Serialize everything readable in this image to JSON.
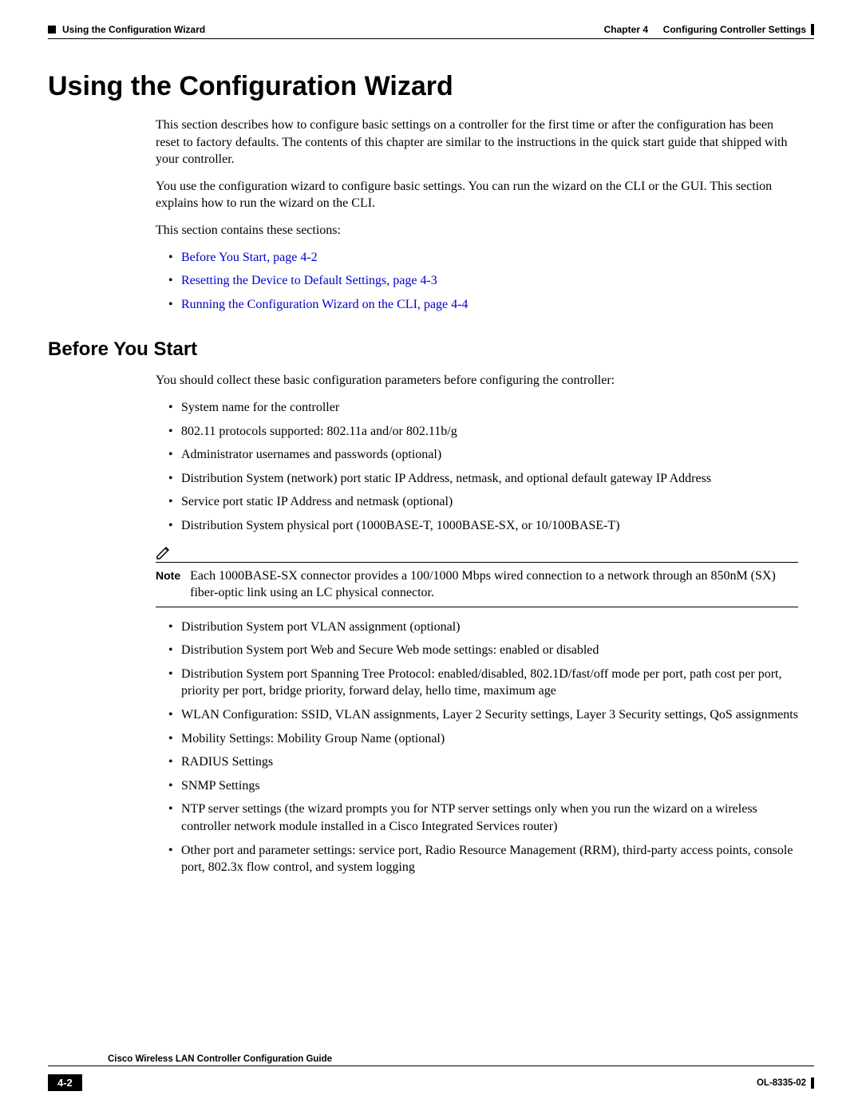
{
  "header": {
    "section_marker": "Using the Configuration Wizard",
    "chapter_label": "Chapter 4",
    "chapter_title": "Configuring Controller Settings"
  },
  "title": "Using the Configuration Wizard",
  "intro": {
    "p1": "This section describes how to configure basic settings on a controller for the first time or after the configuration has been reset to factory defaults. The contents of this chapter are similar to the instructions in the quick start guide that shipped with your controller.",
    "p2": "You use the configuration wizard to configure basic settings. You can run the wizard on the CLI or the GUI. This section explains how to run the wizard on the CLI.",
    "p3": "This section contains these sections:"
  },
  "toc_links": [
    "Before You Start, page 4-2",
    "Resetting the Device to Default Settings, page 4-3",
    "Running the Configuration Wizard on the CLI, page 4-4"
  ],
  "before_you_start": {
    "heading": "Before You Start",
    "intro": "You should collect these basic configuration parameters before configuring the controller:",
    "items_top": [
      "System name for the controller",
      "802.11 protocols supported: 802.11a and/or 802.11b/g",
      "Administrator usernames and passwords (optional)",
      "Distribution System (network) port static IP Address, netmask, and optional default gateway IP Address",
      "Service port static IP Address and netmask (optional)",
      "Distribution System physical port (1000BASE-T, 1000BASE-SX, or 10/100BASE-T)"
    ],
    "note_label": "Note",
    "note_text": "Each 1000BASE-SX connector provides a 100/1000 Mbps wired connection to a network through an 850nM (SX) fiber-optic link using an LC physical connector.",
    "items_bottom": [
      "Distribution System port VLAN assignment (optional)",
      "Distribution System port Web and Secure Web mode settings: enabled or disabled",
      "Distribution System port Spanning Tree Protocol: enabled/disabled, 802.1D/fast/off mode per port, path cost per port, priority per port, bridge priority, forward delay, hello time, maximum age",
      "WLAN Configuration: SSID, VLAN assignments, Layer 2 Security settings, Layer 3 Security settings, QoS assignments",
      "Mobility Settings: Mobility Group Name (optional)",
      "RADIUS Settings",
      "SNMP Settings",
      "NTP server settings (the wizard prompts you for NTP server settings only when you run the wizard on a wireless controller network module installed in a Cisco Integrated Services router)",
      "Other port and parameter settings: service port, Radio Resource Management (RRM), third-party access points, console port, 802.3x flow control, and system logging"
    ]
  },
  "footer": {
    "guide_title": "Cisco Wireless LAN Controller Configuration Guide",
    "page_num": "4-2",
    "doc_id": "OL-8335-02"
  }
}
